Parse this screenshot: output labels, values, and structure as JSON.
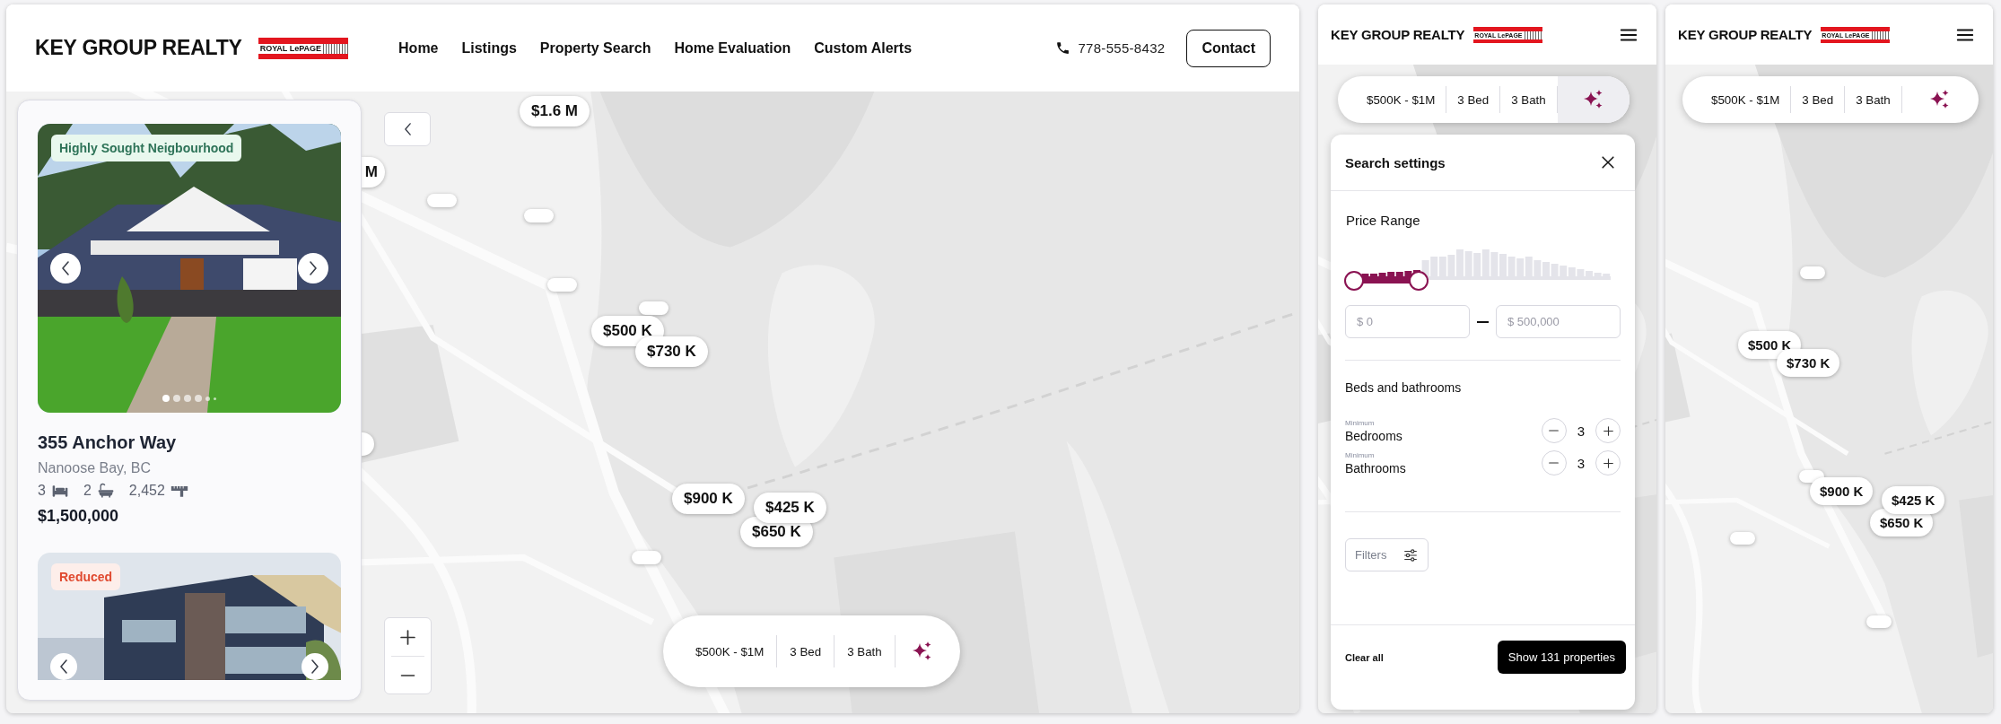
{
  "desktop": {
    "header": {
      "brand": "KEY GROUP REALTY",
      "partner_logo": "ROYAL LePAGE",
      "nav": [
        {
          "label": "Home"
        },
        {
          "label": "Listings"
        },
        {
          "label": "Property Search"
        },
        {
          "label": "Home Evaluation"
        },
        {
          "label": "Custom Alerts"
        }
      ],
      "phone": "778-555-8432",
      "contact_button": "Contact"
    },
    "listings": [
      {
        "tag": {
          "label": "Highly Sought Neigbourhood",
          "kind": "feature"
        },
        "photo_dots": [
          {
            "selected": true
          },
          {
            "selected": false
          },
          {
            "selected": false
          },
          {
            "selected": false
          },
          {
            "selected": false
          },
          {
            "selected": false
          }
        ],
        "title": "355 Anchor Way",
        "location": "Nanoose Bay, BC",
        "beds": "3",
        "baths": "2",
        "area": "2,452",
        "price": "$1,500,000"
      },
      {
        "tag": {
          "label": "Reduced",
          "kind": "reduced"
        }
      }
    ],
    "map": {
      "markers": [
        {
          "kind": "empty"
        },
        {
          "kind": "empty"
        },
        {
          "kind": "empty"
        },
        {
          "kind": "empty"
        },
        {
          "kind": "empty"
        },
        {
          "kind": "empty"
        },
        {
          "kind": "price",
          "label": "$1.6 M"
        },
        {
          "kind": "price",
          "label": "M"
        },
        {
          "kind": "price",
          "label": "$500 K"
        },
        {
          "kind": "price",
          "label": "$730 K"
        },
        {
          "kind": "price",
          "label": "$900 K"
        },
        {
          "kind": "price",
          "label": "$650 K"
        },
        {
          "kind": "price",
          "label": "$425 K"
        }
      ]
    },
    "filter_bar": {
      "segments": [
        {
          "label": "$500K - $1M"
        },
        {
          "label": "3 Bed"
        },
        {
          "label": "3 Bath"
        }
      ],
      "ai_button": {
        "selected": false
      }
    }
  },
  "mobile_settings": {
    "header": {
      "brand": "KEY GROUP REALTY",
      "partner_logo": "ROYAL LePAGE"
    },
    "filter_bar": {
      "segments": [
        {
          "label": "$500K - $1M"
        },
        {
          "label": "3 Bed"
        },
        {
          "label": "3 Bath"
        }
      ],
      "ai_button": {
        "selected": true
      }
    },
    "settings_sheet": {
      "title": "Search settings",
      "price_range": {
        "label": "Price Range",
        "min_thumb": {
          "level": 0
        },
        "max_thumb": {
          "level": 0.25
        },
        "min_field": {
          "placeholder": "$ 0"
        },
        "max_field": {
          "placeholder": "$ 500,000"
        }
      },
      "beds_baths": {
        "title": "Beds and bathrooms",
        "counters": [
          {
            "caption": "Minimum",
            "label": "Bedrooms",
            "value": "3"
          },
          {
            "caption": "Minimum",
            "label": "Bathrooms",
            "value": "3"
          }
        ]
      },
      "filters_button": "Filters",
      "clear_button": "Clear all",
      "show_button": "Show 131 properties"
    }
  },
  "mobile_map": {
    "header": {
      "brand": "KEY GROUP REALTY",
      "partner_logo": "ROYAL LePAGE"
    },
    "filter_bar": {
      "segments": [
        {
          "label": "$500K - $1M"
        },
        {
          "label": "3 Bed"
        },
        {
          "label": "3 Bath"
        }
      ],
      "ai_button": {
        "selected": false
      }
    },
    "map": {
      "markers": [
        {
          "kind": "empty"
        },
        {
          "kind": "empty"
        },
        {
          "kind": "empty"
        },
        {
          "kind": "empty"
        },
        {
          "kind": "price",
          "label": "$500 K"
        },
        {
          "kind": "price",
          "label": "$730 K"
        },
        {
          "kind": "price",
          "label": "$900 K"
        },
        {
          "kind": "price",
          "label": "$650 K"
        },
        {
          "kind": "price",
          "label": "$425 K"
        }
      ]
    }
  }
}
